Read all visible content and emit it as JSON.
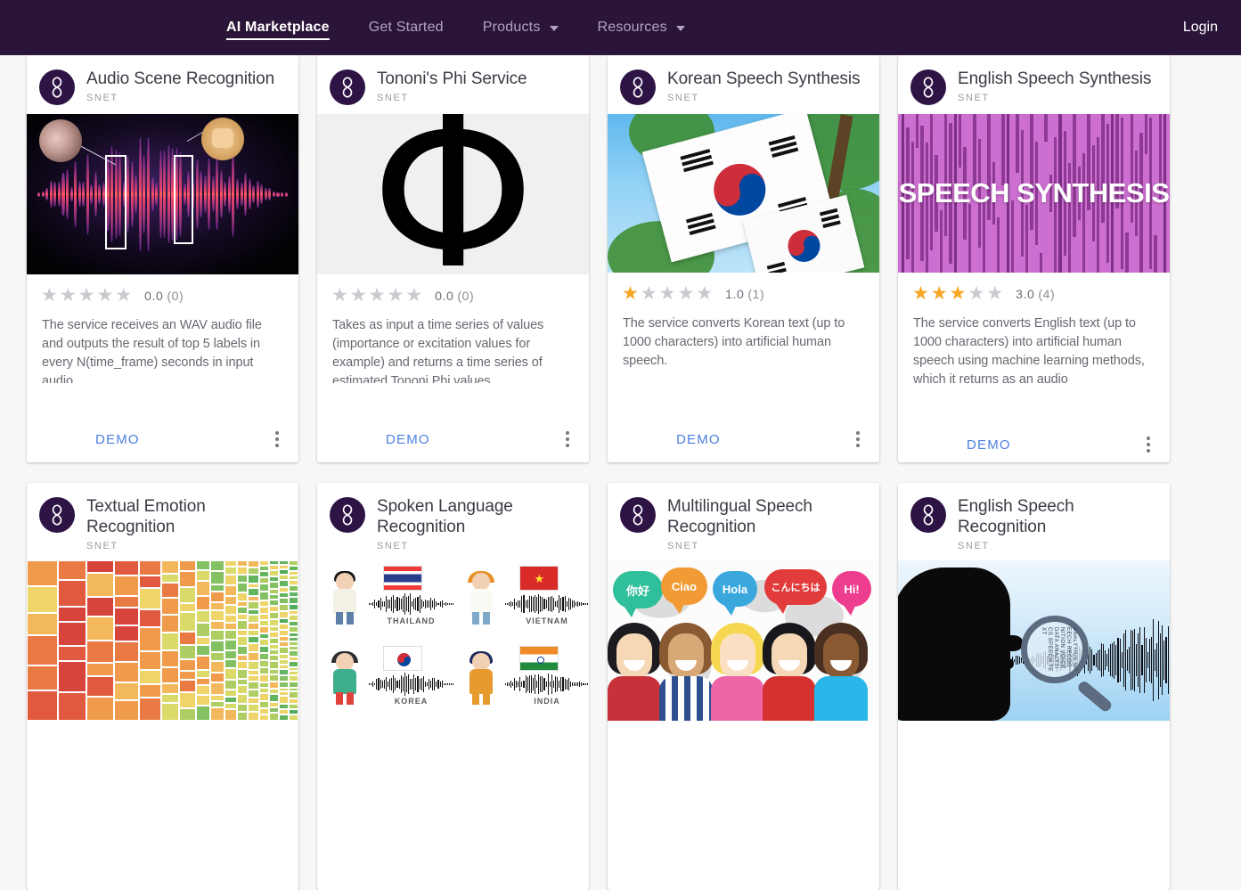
{
  "nav": {
    "items": [
      {
        "label": "AI Marketplace",
        "active": true,
        "has_caret": false
      },
      {
        "label": "Get Started",
        "active": false,
        "has_caret": false
      },
      {
        "label": "Products",
        "active": false,
        "has_caret": true
      },
      {
        "label": "Resources",
        "active": false,
        "has_caret": true
      }
    ],
    "login_label": "Login",
    "bar_color": "#2a1538"
  },
  "colors": {
    "nav_background": "#2a1538",
    "logo_circle": "#2e1345",
    "demo_link": "#4d7fe0",
    "star_filled": "#f5a623",
    "star_empty": "#c9c9cf",
    "card_background": "#ffffff",
    "page_background": "#f7f7f7"
  },
  "cards": [
    {
      "title": "Audio Scene Recognition",
      "org": "SNET",
      "rating_value": "0.0",
      "rating_count": "(0)",
      "stars_filled": 0,
      "description": "The service receives an WAV audio file and outputs the result of top 5 labels in every N(time_frame) seconds in input audio.",
      "demo_label": "DEMO",
      "media_kind": "audio-waveform-scene"
    },
    {
      "title": "Tononi's Phi Service",
      "org": "SNET",
      "rating_value": "0.0",
      "rating_count": "(0)",
      "stars_filled": 0,
      "description": "Takes as input a time series of values (importance or excitation values for example) and returns a time series of estimated Tononi Phi values.",
      "demo_label": "DEMO",
      "media_kind": "phi-glyph",
      "media_glyph": "Φ"
    },
    {
      "title": "Korean Speech Synthesis",
      "org": "SNET",
      "rating_value": "1.0",
      "rating_count": "(1)",
      "stars_filled": 1,
      "description": "The service converts Korean text (up to 1000 characters) into artificial human speech.",
      "demo_label": "DEMO",
      "media_kind": "korean-flag-photo"
    },
    {
      "title": "English Speech Synthesis",
      "org": "SNET",
      "rating_value": "3.0",
      "rating_count": "(4)",
      "stars_filled": 3,
      "description": "The service converts English text (up to 1000 characters) into artificial human speech using machine learning methods, which it returns as an audio",
      "demo_label": "DEMO",
      "media_kind": "speech-synthesis-banner",
      "media_text": "SPEECH SYNTHESIS"
    },
    {
      "title": "Textual Emotion Recognition",
      "org": "SNET",
      "media_kind": "treemap"
    },
    {
      "title": "Spoken Language Recognition",
      "org": "SNET",
      "media_kind": "language-grid",
      "media_labels": [
        "THAILAND",
        "VIETNAM",
        "KOREA",
        "INDIA"
      ]
    },
    {
      "title": "Multilingual Speech Recognition",
      "org": "SNET",
      "media_kind": "people-greetings",
      "media_bubbles": [
        {
          "text": "你好",
          "color": "#2fbf9a"
        },
        {
          "text": "Ciao",
          "color": "#f29a33"
        },
        {
          "text": "Hola",
          "color": "#3aa8dd"
        },
        {
          "text": "こんにちは",
          "color": "#e23b3b"
        },
        {
          "text": "Hi!",
          "color": "#ec3d8e"
        }
      ]
    },
    {
      "title": "English Speech Recognition",
      "org": "SNET",
      "media_kind": "head-silhouette-magnifier"
    }
  ]
}
